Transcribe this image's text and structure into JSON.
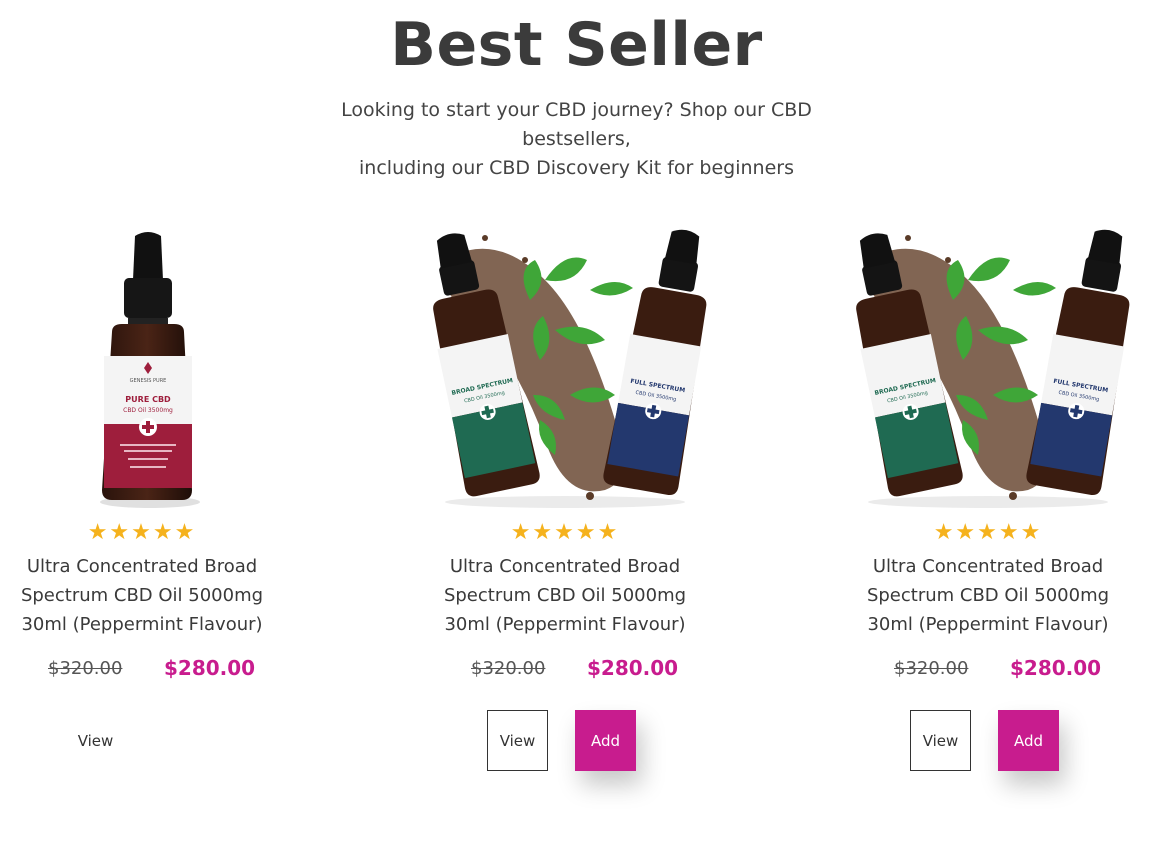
{
  "header": {
    "title": "Best Seller",
    "subtitle_line1": "Looking to start your CBD journey? Shop our CBD bestsellers,",
    "subtitle_line2": "including our CBD Discovery Kit for beginners"
  },
  "colors": {
    "accent": "#c81c8e",
    "star": "#f5b21d",
    "text": "#3b3b3b"
  },
  "products": [
    {
      "stars": "★★★★★",
      "name_line1": "Ultra Concentrated Broad",
      "name_line2": "Spectrum CBD Oil 5000mg",
      "name_line3": "30ml (Peppermint Flavour)",
      "old_price": "$320.00",
      "price": "$280.00",
      "view_label": "View",
      "image": "pure-cbd-oil-bottle",
      "label_brand": "GENESIS PURE",
      "label_title": "PURE CBD",
      "label_sub": "CBD Oil 3500mg"
    },
    {
      "stars": "★★★★★",
      "name_line1": "Ultra Concentrated Broad",
      "name_line2": "Spectrum CBD Oil 5000mg",
      "name_line3": "30ml (Peppermint Flavour)",
      "old_price": "$320.00",
      "price": "$280.00",
      "view_label": "View",
      "add_label": "Add",
      "image": "two-bottles-with-leaves",
      "left_bottle": "BROAD SPECTRUM",
      "right_bottle": "FULL SPECTRUM",
      "bottle_sub": "CBD Oil 3500mg"
    },
    {
      "stars": "★★★★★",
      "name_line1": "Ultra Concentrated Broad",
      "name_line2": "Spectrum CBD Oil 5000mg",
      "name_line3": "30ml (Peppermint Flavour)",
      "old_price": "$320.00",
      "price": "$280.00",
      "view_label": "View",
      "add_label": "Add",
      "image": "two-bottles-with-leaves",
      "left_bottle": "BROAD SPECTRUM",
      "right_bottle": "FULL SPECTRUM",
      "bottle_sub": "CBD Oil 3500mg"
    }
  ]
}
